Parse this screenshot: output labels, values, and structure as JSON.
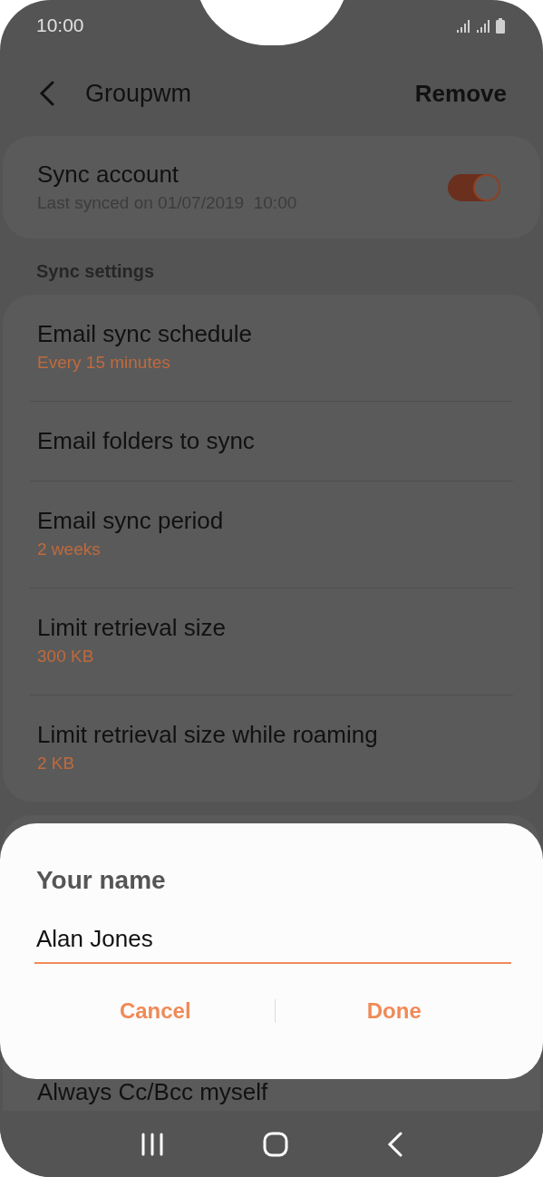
{
  "status_bar": {
    "time": "10:00"
  },
  "header": {
    "title": "Groupwm",
    "action": "Remove"
  },
  "account_card": {
    "title": "Sync account",
    "subtitle": "Last synced on 01/07/2019  10:00",
    "toggle_on": true
  },
  "section_title": "Sync settings",
  "settings": [
    {
      "title": "Email sync schedule",
      "value": "Every 15 minutes"
    },
    {
      "title": "Email folders to sync"
    },
    {
      "title": "Email sync period",
      "value": "2 weeks"
    },
    {
      "title": "Limit retrieval size",
      "value": "300 KB"
    },
    {
      "title": "Limit retrieval size while roaming",
      "value": "2 KB"
    }
  ],
  "partial_row": {
    "title": "Always Cc/Bcc myself"
  },
  "dialog": {
    "title": "Your name",
    "field": {
      "value": "Alan Jones"
    },
    "buttons": [
      "Cancel",
      "Done"
    ]
  }
}
